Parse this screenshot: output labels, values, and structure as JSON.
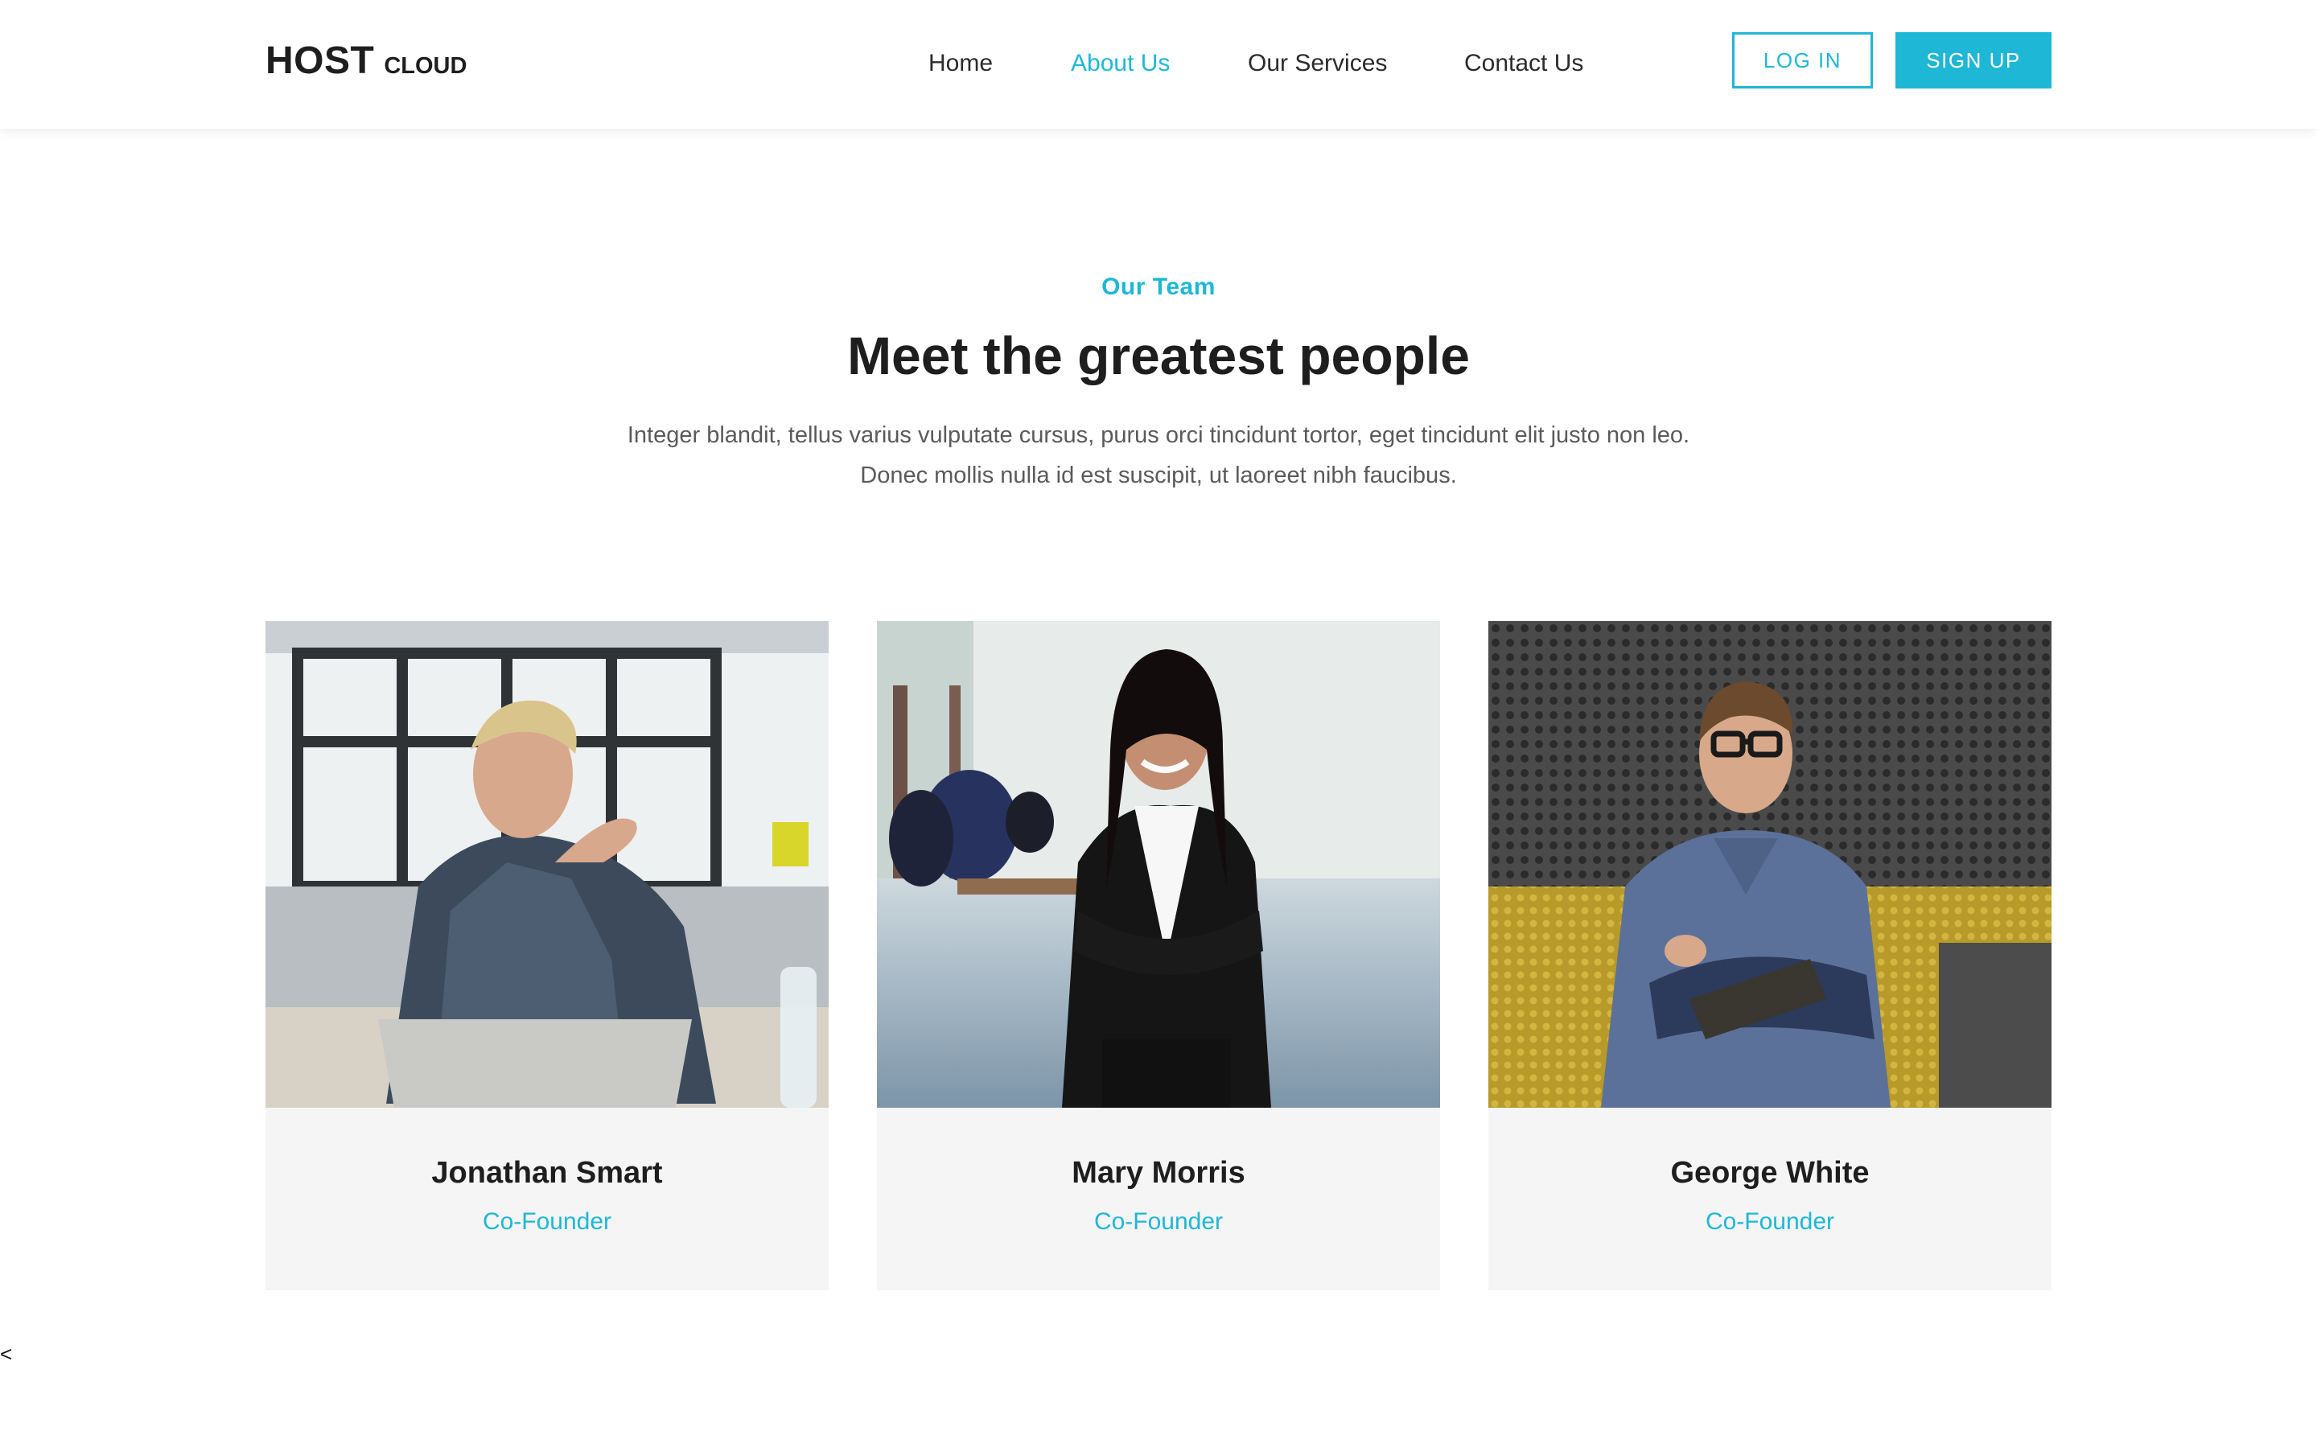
{
  "brand": {
    "name": "HOST",
    "suffix": "CLOUD"
  },
  "nav": {
    "items": [
      {
        "label": "Home",
        "active": false
      },
      {
        "label": "About Us",
        "active": true
      },
      {
        "label": "Our Services",
        "active": false
      },
      {
        "label": "Contact Us",
        "active": false
      }
    ],
    "login_label": "LOG IN",
    "signup_label": "SIGN UP"
  },
  "intro": {
    "eyebrow": "Our Team",
    "title": "Meet the greatest people",
    "description_line1": "Integer blandit, tellus varius vulputate cursus, purus orci tincidunt tortor, eget tincidunt elit justo non leo.",
    "description_line2": "Donec mollis nulla id est suscipit, ut laoreet nibh faucibus."
  },
  "team": [
    {
      "name": "Jonathan Smart",
      "role": "Co-Founder"
    },
    {
      "name": "Mary Morris",
      "role": "Co-Founder"
    },
    {
      "name": "George White",
      "role": "Co-Founder"
    }
  ],
  "footer": {
    "stray_text": "<"
  },
  "colors": {
    "accent": "#1fb7d6",
    "heading": "#1e1e1e",
    "body_text": "#5a5a5a",
    "card_background": "#f5f5f5"
  }
}
